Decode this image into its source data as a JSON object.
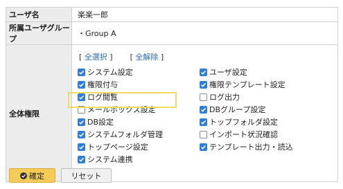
{
  "form": {
    "user_label": "ユーザ名",
    "user_value": "楽楽一郎",
    "group_label": "所属ユーザグループ",
    "group_value": "・Group A",
    "perm_label": "全体権限",
    "select_all_open": "[",
    "select_all": "全選択",
    "select_all_close": "]",
    "deselect_all_open": "[",
    "deselect_all": "全解除",
    "deselect_all_close": "]"
  },
  "permissions": [
    {
      "label": "システム設定",
      "checked": true
    },
    {
      "label": "ユーザ設定",
      "checked": true
    },
    {
      "label": "権限付与",
      "checked": true
    },
    {
      "label": "権限テンプレート設定",
      "checked": true
    },
    {
      "label": "ログ閲覧",
      "checked": true
    },
    {
      "label": "ログ出力",
      "checked": false
    },
    {
      "label": "メールボックス設定",
      "checked": false
    },
    {
      "label": "DBグループ設定",
      "checked": true
    },
    {
      "label": "DB設定",
      "checked": true
    },
    {
      "label": "トップフォルダ設定",
      "checked": true
    },
    {
      "label": "システムフォルダ管理",
      "checked": true
    },
    {
      "label": "インポート状況確認",
      "checked": false
    },
    {
      "label": "トップページ設定",
      "checked": true
    },
    {
      "label": "テンプレート出力・読込",
      "checked": true
    },
    {
      "label": "システム連携",
      "checked": true
    }
  ],
  "buttons": {
    "confirm": "確定",
    "reset": "リセット"
  },
  "colors": {
    "checkbox_on": "#2f7fd8",
    "highlight": "#f0dc60",
    "confirm_button": "#f5cb57",
    "link": "#2a6db5"
  }
}
